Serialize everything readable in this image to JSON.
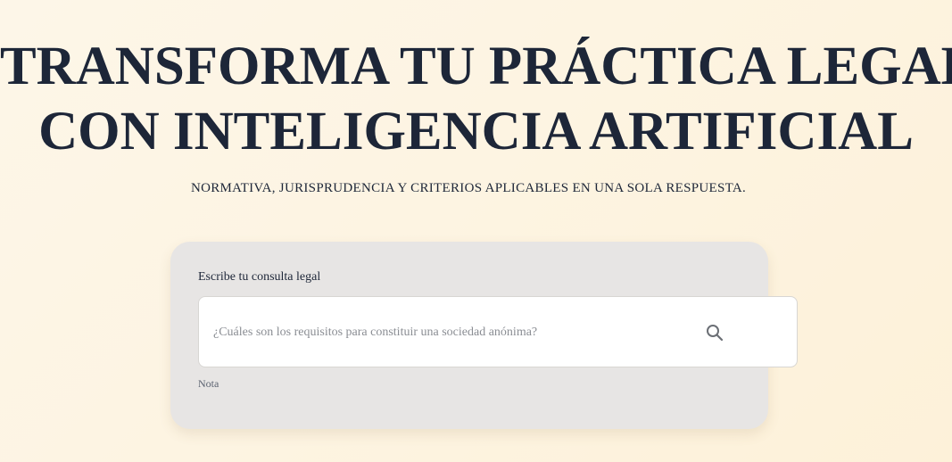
{
  "hero": {
    "title_line1": "TRANSFORMA TU PRÁCTICA LEGAL",
    "title_line2": "CON INTELIGENCIA ARTIFICIAL",
    "subtitle": "NORMATIVA, JURISPRUDENCIA Y CRITERIOS APLICABLES EN UNA SOLA RESPUESTA."
  },
  "query_card": {
    "label": "Escribe tu consulta legal",
    "input_value": "",
    "input_placeholder": "¿Cuáles son los requisitos para constituir una sociedad anónima?",
    "search_icon": "search-icon",
    "note": "Nota"
  },
  "colors": {
    "text_primary": "#1d2638",
    "card_background": "#e7e5e4",
    "input_background": "#ffffff",
    "placeholder": "#8a8d93",
    "page_background": "#fdf4e2"
  }
}
